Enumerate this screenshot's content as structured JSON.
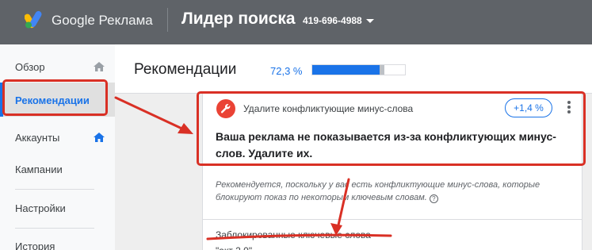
{
  "header": {
    "brand": "Google Реклама",
    "account_name": "Лидер поиска",
    "account_id": "419-696-4988"
  },
  "sidebar": {
    "items": [
      {
        "label": "Обзор"
      },
      {
        "label": "Рекомендации"
      },
      {
        "label": "Аккаунты"
      },
      {
        "label": "Кампании"
      },
      {
        "label": "Настройки"
      },
      {
        "label": "История"
      }
    ]
  },
  "page": {
    "title": "Рекомендации",
    "optimization_score": "72,3 %",
    "optimization_score_fraction": 0.723,
    "score_uplift_fraction": 0.014
  },
  "recommendation": {
    "title": "Удалите конфликтующие минус-слова",
    "uplift": "+1,4 %",
    "description": "Ваша реклама не показывается из-за конфликтующих минус-слов. Удалите их.",
    "reason": "Рекомендуется, поскольку у вас есть конфликтующие минус-слова, которые блокируют показ по некоторым ключевым словам.",
    "help": "?",
    "blocked_label": "Заблокированные ключевые слова",
    "keyword_partial": "\"акт 2.0\""
  },
  "colors": {
    "topbar": "#5f6368",
    "accent": "#1a73e8",
    "annotation": "#d93025"
  },
  "icons": [
    "google-ads-logo-icon",
    "dropdown-caret-icon",
    "home-icon",
    "wrench-icon",
    "more-vert-icon",
    "help-icon"
  ]
}
